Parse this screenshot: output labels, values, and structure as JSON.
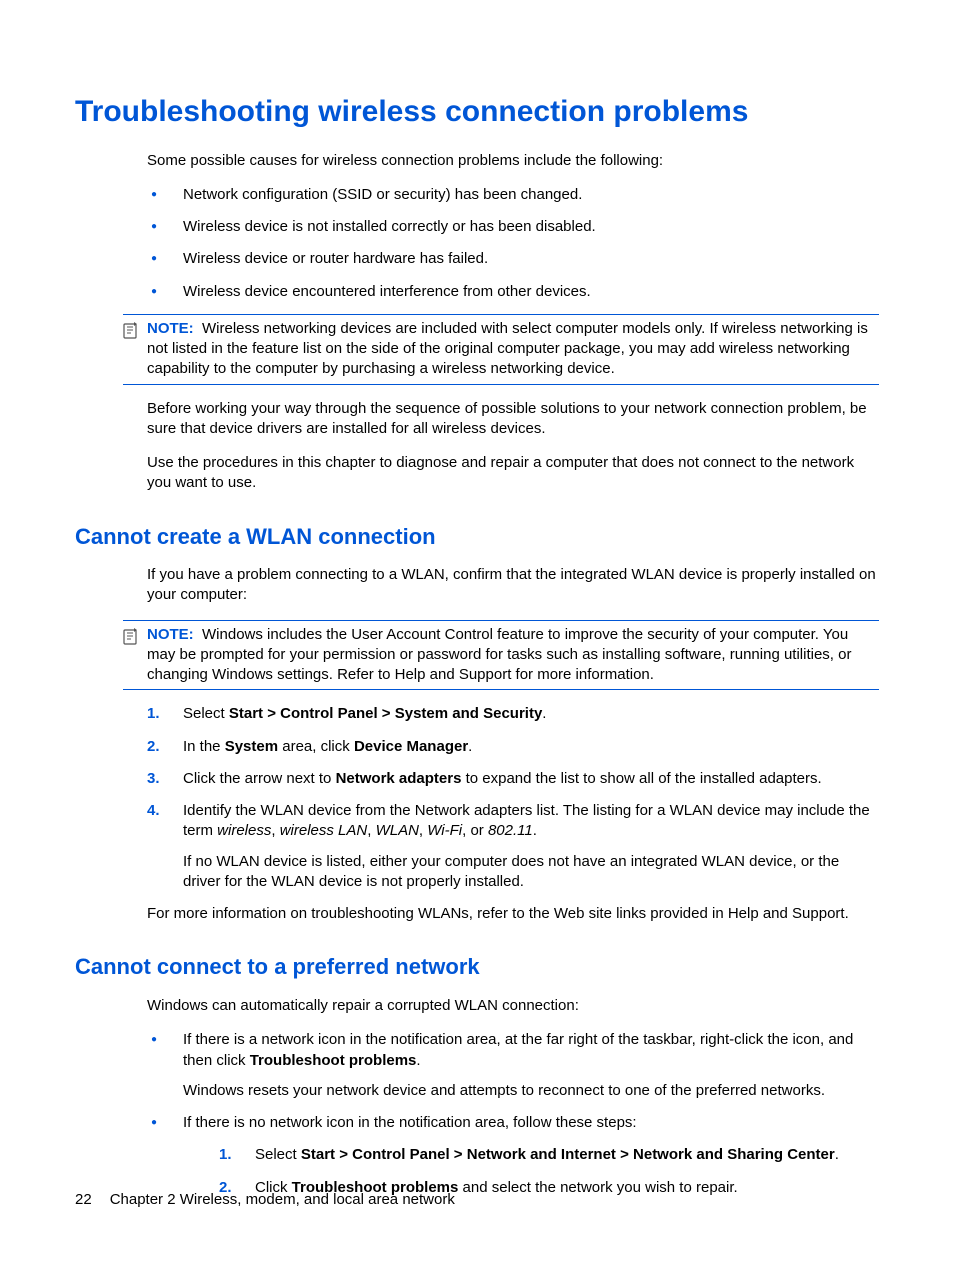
{
  "h1": "Troubleshooting wireless connection problems",
  "intro": "Some possible causes for wireless connection problems include the following:",
  "causes": [
    "Network configuration (SSID or security) has been changed.",
    "Wireless device is not installed correctly or has been disabled.",
    "Wireless device or router hardware has failed.",
    "Wireless device encountered interference from other devices."
  ],
  "note1_label": "NOTE:",
  "note1_text": "Wireless networking devices are included with select computer models only. If wireless networking is not listed in the feature list on the side of the original computer package, you may add wireless networking capability to the computer by purchasing a wireless networking device.",
  "para_before": "Before working your way through the sequence of possible solutions to your network connection problem, be sure that device drivers are installed for all wireless devices.",
  "para_use": "Use the procedures in this chapter to diagnose and repair a computer that does not connect to the network you want to use.",
  "h2a": "Cannot create a WLAN connection",
  "wlan_intro": "If you have a problem connecting to a WLAN, confirm that the integrated WLAN device is properly installed on your computer:",
  "note2_label": "NOTE:",
  "note2_text": "Windows includes the User Account Control feature to improve the security of your computer. You may be prompted for your permission or password for tasks such as installing software, running utilities, or changing Windows settings. Refer to Help and Support for more information.",
  "step1_pre": "Select ",
  "step1_bold": "Start > Control Panel > System and Security",
  "step1_post": ".",
  "step2_pre": "In the ",
  "step2_b1": "System",
  "step2_mid": " area, click ",
  "step2_b2": "Device Manager",
  "step2_post": ".",
  "step3_pre": "Click the arrow next to ",
  "step3_bold": "Network adapters",
  "step3_post": " to expand the list to show all of the installed adapters.",
  "step4_pre": "Identify the WLAN device from the Network adapters list. The listing for a WLAN device may include the term ",
  "step4_i1": "wireless",
  "step4_c1": ", ",
  "step4_i2": "wireless LAN",
  "step4_c2": ", ",
  "step4_i3": "WLAN",
  "step4_c3": ", ",
  "step4_i4": "Wi-Fi",
  "step4_c4": ", or ",
  "step4_i5": "802.11",
  "step4_post": ".",
  "step4_sub": "If no WLAN device is listed, either your computer does not have an integrated WLAN device, or the driver for the WLAN device is not properly installed.",
  "wlan_more": "For more information on troubleshooting WLANs, refer to the Web site links provided in Help and Support.",
  "h2b": "Cannot connect to a preferred network",
  "pref_intro": "Windows can automatically repair a corrupted WLAN connection:",
  "pref_b1_pre": "If there is a network icon in the notification area, at the far right of the taskbar, right-click the icon, and then click ",
  "pref_b1_bold": "Troubleshoot problems",
  "pref_b1_post": ".",
  "pref_b1_sub": "Windows resets your network device and attempts to reconnect to one of the preferred networks.",
  "pref_b2": "If there is no network icon in the notification area, follow these steps:",
  "pref_s1_pre": "Select ",
  "pref_s1_bold": "Start > Control Panel > Network and Internet > Network and Sharing Center",
  "pref_s1_post": ".",
  "pref_s2_pre": "Click ",
  "pref_s2_bold": "Troubleshoot problems",
  "pref_s2_post": " and select the network you wish to repair.",
  "footer_page": "22",
  "footer_chapter": "Chapter 2   Wireless, modem, and local area network"
}
